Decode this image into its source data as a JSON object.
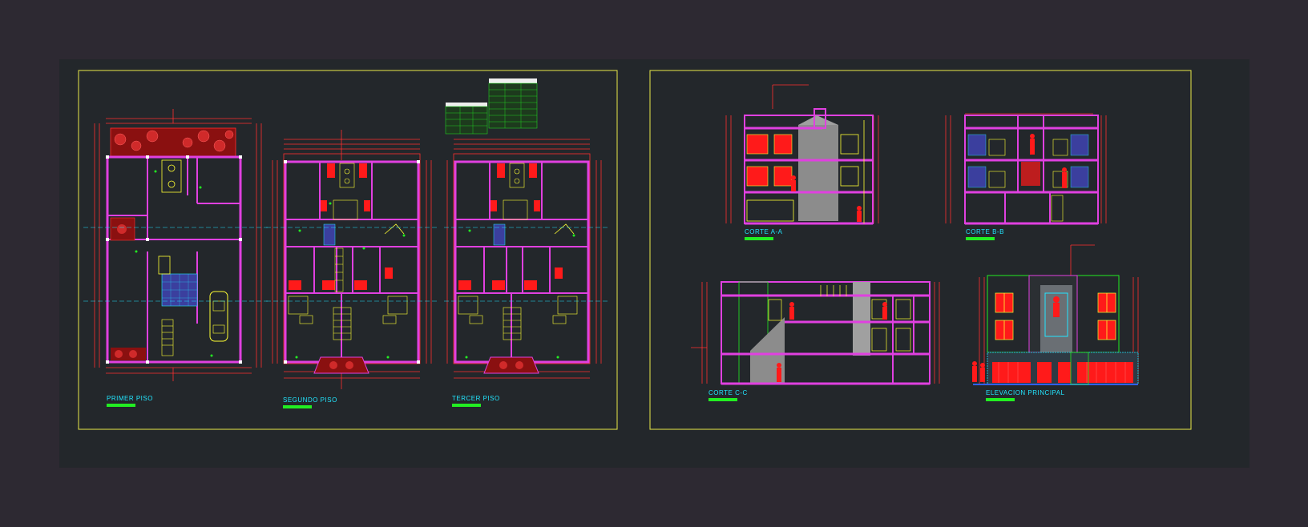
{
  "drawing": {
    "views": [
      {
        "id": "primer",
        "title": "PRIMER PISO"
      },
      {
        "id": "segundo",
        "title": "SEGUNDO PISO"
      },
      {
        "id": "tercer",
        "title": "TERCER PISO"
      },
      {
        "id": "corte_aa",
        "title": "CORTE A-A"
      },
      {
        "id": "corte_bb",
        "title": "CORTE B-B"
      },
      {
        "id": "corte_cc",
        "title": "CORTE C-C"
      },
      {
        "id": "elevacion",
        "title": "ELEVACION PRINCIPAL"
      }
    ]
  },
  "colors": {
    "background": "#2d2932",
    "sheet": "#23272b",
    "frame": "#e8e84a",
    "wall": "#e040e0",
    "dimension": "#ff3030",
    "label": "#22e6ff",
    "underline": "#22ee22",
    "fill_red": "#ff1a1a",
    "furniture": "#ffff33",
    "tree": "#b01a1a"
  }
}
